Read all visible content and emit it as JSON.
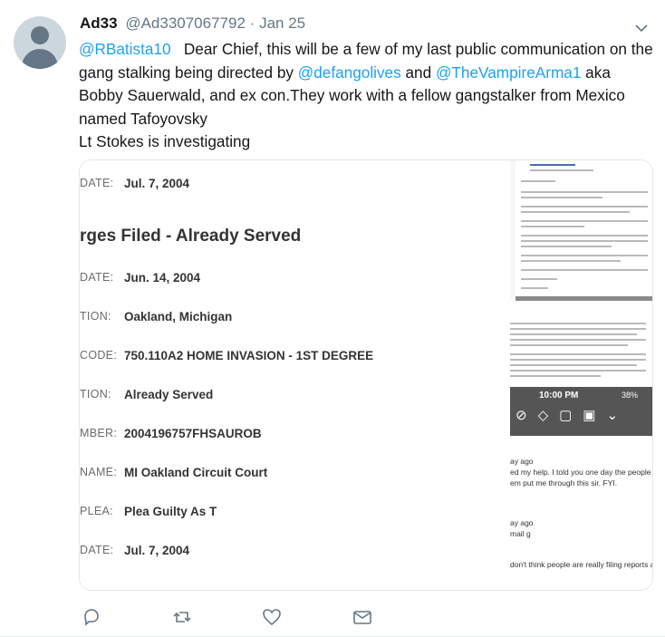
{
  "tweet": {
    "display_name": "Ad33",
    "handle": "@Ad3307067792",
    "separator": "·",
    "date": "Jan 25",
    "text": {
      "mention1": "@RBatista10",
      "part1": "Dear Chief, this will be a few of my last public communication on the gang stalking being directed by",
      "mention2": "@defangolives",
      "part2": "and",
      "mention3": "@TheVampireArma1",
      "part3": "aka Bobby Sauerwald, and ex con.They work with a fellow gangstalker from Mexico named Tafoyovsky",
      "part4": "Lt Stokes is investigating"
    }
  },
  "media": {
    "doc": {
      "section_title": "rges Filed - Already Served",
      "rows": [
        {
          "label": "DATE:",
          "value": "Jul. 7, 2004"
        },
        {
          "label": "DATE:",
          "value": "Jun. 14, 2004"
        },
        {
          "label": "TION:",
          "value": "Oakland, Michigan"
        },
        {
          "label": "CODE:",
          "value": "750.110A2 HOME INVASION - 1ST DEGREE"
        },
        {
          "label": "TION:",
          "value": "Already Served"
        },
        {
          "label": "MBER:",
          "value": "2004196757FHSAUROB"
        },
        {
          "label": "NAME:",
          "value": "MI Oakland Circuit Court"
        },
        {
          "label": "PLEA:",
          "value": "Plea Guilty As T"
        },
        {
          "label": "DATE:",
          "value": "Jul. 7, 2004"
        }
      ]
    },
    "phone": {
      "time": "10:00 PM",
      "battery": "38%"
    },
    "snippets": [
      "ay ago",
      "ed my help.   I told you one day the people you were f",
      "em put me through this sir.  FYI.",
      "ay ago",
      "mail g",
      "don't think people are really filing reports and shit."
    ]
  },
  "actions": {
    "reply": "reply",
    "retweet": "retweet",
    "like": "like",
    "message": "direct-message"
  }
}
